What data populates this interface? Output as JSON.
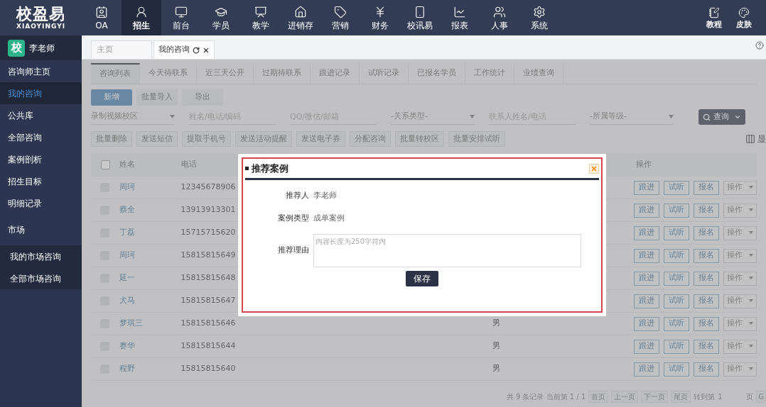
{
  "app": {
    "logo_text": "校盈易",
    "logo_subtext": "XIAOYINGYI"
  },
  "nav": [
    {
      "label": "OA",
      "selected": false
    },
    {
      "label": "招生",
      "selected": true
    },
    {
      "label": "前台",
      "selected": false
    },
    {
      "label": "学员",
      "selected": false
    },
    {
      "label": "教学",
      "selected": false
    },
    {
      "label": "进销存",
      "selected": false
    },
    {
      "label": "营销",
      "selected": false
    },
    {
      "label": "财务",
      "selected": false
    },
    {
      "label": "校讯易",
      "selected": false
    },
    {
      "label": "报表",
      "selected": false
    },
    {
      "label": "人事",
      "selected": false
    },
    {
      "label": "系统",
      "selected": false
    }
  ],
  "nav_right": [
    {
      "label": "教程"
    },
    {
      "label": "皮肤"
    }
  ],
  "user": {
    "badge": "校",
    "name": "李老师"
  },
  "sidebar": [
    {
      "label": "咨询师主页",
      "kind": "item",
      "selected": false
    },
    {
      "label": "我的咨询",
      "kind": "item",
      "selected": true
    },
    {
      "label": "公共库",
      "kind": "item",
      "selected": false
    },
    {
      "label": "全部咨询",
      "kind": "item",
      "selected": false
    },
    {
      "label": "案例剖析",
      "kind": "item",
      "selected": false
    },
    {
      "label": "招生目标",
      "kind": "item",
      "selected": false
    },
    {
      "label": "明细记录",
      "kind": "item",
      "selected": false
    },
    {
      "label": "市场",
      "kind": "section"
    },
    {
      "label": "我的市场咨询",
      "kind": "subitem",
      "selected": false
    },
    {
      "label": "全部市场咨询",
      "kind": "subitem",
      "selected": false
    }
  ],
  "page_tabs": [
    {
      "label": "主页",
      "selected": false,
      "closable": false
    },
    {
      "label": "我的咨询",
      "selected": true,
      "closable": true
    }
  ],
  "sub_tabs": [
    {
      "label": "咨询列表",
      "selected": true
    },
    {
      "label": "今天待联系",
      "selected": false
    },
    {
      "label": "近三天公开",
      "selected": false
    },
    {
      "label": "过期待联系",
      "selected": false
    },
    {
      "label": "跟进记录",
      "selected": false
    },
    {
      "label": "试听记录",
      "selected": false
    },
    {
      "label": "已报名学员",
      "selected": false
    },
    {
      "label": "工作统计",
      "selected": false
    },
    {
      "label": "业绩查询",
      "selected": false
    }
  ],
  "action_buttons": [
    {
      "label": "新增",
      "kind": "primary"
    },
    {
      "label": "批量导入",
      "kind": "default"
    },
    {
      "label": "导出",
      "kind": "default"
    }
  ],
  "filters": [
    {
      "kind": "select",
      "placeholder": "录制视频校区"
    },
    {
      "kind": "input",
      "placeholder": "姓名/电话/编码"
    },
    {
      "kind": "input",
      "placeholder": "QQ/微信/邮箱"
    },
    {
      "kind": "select",
      "placeholder": "-关系类型-"
    },
    {
      "kind": "input",
      "placeholder": "联系人姓名/电话"
    },
    {
      "kind": "select",
      "placeholder": "-所属等级-"
    }
  ],
  "search_button": {
    "label": "查询"
  },
  "batch_buttons": [
    "批量删除",
    "发送短信",
    "提取手机号",
    "发送活动提醒",
    "发送电子券",
    "分配咨询",
    "批量转校区",
    "批量安排试听"
  ],
  "column_toggle": {
    "label": "显"
  },
  "table": {
    "all_checked": false,
    "columns": [
      {
        "kind": "check"
      },
      {
        "kind": "name",
        "label": "姓名"
      },
      {
        "kind": "phone",
        "label": "电话"
      },
      {
        "kind": "actions",
        "label": "操作"
      }
    ],
    "rows": [
      {
        "checked": false,
        "name": "周珂",
        "phone": "12345678906",
        "actions": [
          "跟进",
          "试听",
          "报名"
        ],
        "menu": "操作"
      },
      {
        "checked": false,
        "name": "蔡全",
        "phone": "13913913301",
        "actions": [
          "跟进",
          "试听",
          "报名"
        ],
        "menu": "操作"
      },
      {
        "checked": false,
        "name": "丁磊",
        "phone": "15715715620",
        "actions": [
          "跟进",
          "试听",
          "报名"
        ],
        "menu": "操作"
      },
      {
        "checked": false,
        "name": "周珂",
        "phone": "15815815649",
        "actions": [
          "跟进",
          "试听",
          "报名"
        ],
        "menu": "操作"
      },
      {
        "checked": false,
        "name": "延一",
        "phone": "15815815648",
        "actions": [
          "跟进",
          "试听",
          "报名"
        ],
        "menu": "操作"
      },
      {
        "checked": false,
        "name": "犬马",
        "phone": "15815815647",
        "actions": [
          "跟进",
          "试听",
          "报名"
        ],
        "menu": "操作"
      },
      {
        "checked": false,
        "name": "梦琪三",
        "phone": "15815815646",
        "gender": "男",
        "actions": [
          "跟进",
          "试听",
          "报名"
        ],
        "menu": "操作"
      },
      {
        "checked": false,
        "name": "赛华",
        "phone": "15815815644",
        "gender": "男",
        "actions": [
          "跟进",
          "试听",
          "报名"
        ],
        "menu": "操作"
      },
      {
        "checked": false,
        "name": "程野",
        "phone": "15815815640",
        "gender": "男",
        "actions": [
          "跟进",
          "试听",
          "报名"
        ],
        "menu": "操作"
      }
    ]
  },
  "pagination": {
    "summary": "共 9 条记录 当前第 1 / 1",
    "buttons": [
      "首页",
      "上一页",
      "下一页",
      "尾页"
    ],
    "goto_label": "转到第",
    "goto_value": "1",
    "page_unit": "页",
    "go_button": "G"
  },
  "dialog": {
    "title": "推荐案例",
    "fields": [
      {
        "kind": "text",
        "label": "推荐人",
        "value": "李老师"
      },
      {
        "kind": "text",
        "label": "案例类型",
        "value": "成单案例"
      },
      {
        "kind": "textarea",
        "label": "推荐理由",
        "placeholder": "内容长度为250字符内"
      }
    ],
    "save_button": "保存"
  }
}
